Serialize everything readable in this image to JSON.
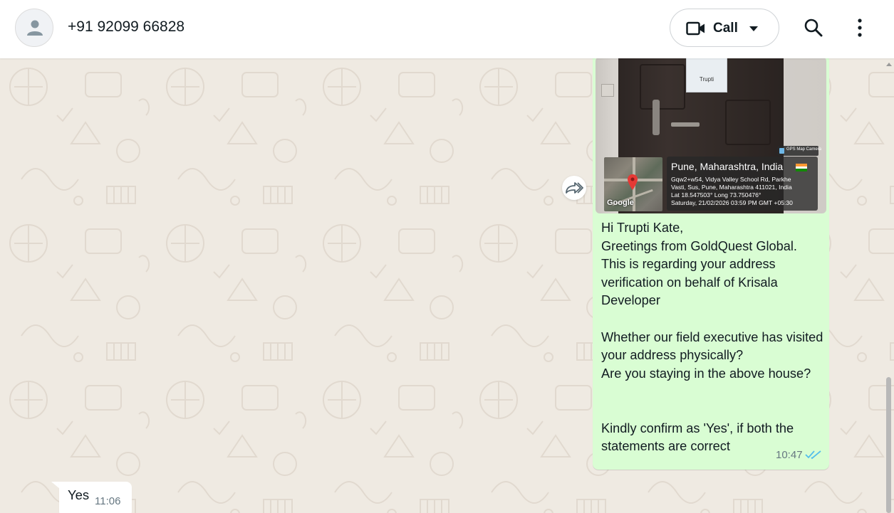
{
  "header": {
    "contact_name": "+91 92099 66828",
    "call_label": "Call"
  },
  "messages": {
    "outgoing": {
      "photo": {
        "door_sticker_text": "Trupti",
        "gps_brand": "GPS Map Camera",
        "gps_location_title": "Pune, Maharashtra, India",
        "gps_address_line1": "Gqw2+w54, Vidya Valley School Rd, Parkhe",
        "gps_address_line2": "Vasti, Sus, Pune, Maharashtra 411021, India",
        "gps_coords": "Lat 18.547503° Long 73.750476°",
        "gps_datetime": "Saturday, 21/02/2026 03:59 PM GMT +05:30",
        "map_logo": "Google"
      },
      "text": "Hi Trupti Kate,\nGreetings from GoldQuest Global.\nThis is regarding your address verification on behalf of Krisala Developer\n\nWhether our field executive has visited your address physically?\nAre you staying in the above house?\n\n\nKindly confirm as 'Yes', if both the statements are correct",
      "time": "10:47",
      "status_icon": "double-tick-read-icon",
      "status_color": "#53bdeb"
    },
    "incoming": {
      "text": "Yes",
      "time": "11:06"
    }
  },
  "colors": {
    "chat_background": "#efeae2",
    "outgoing_bubble": "#d9fdd3",
    "incoming_bubble": "#ffffff"
  }
}
